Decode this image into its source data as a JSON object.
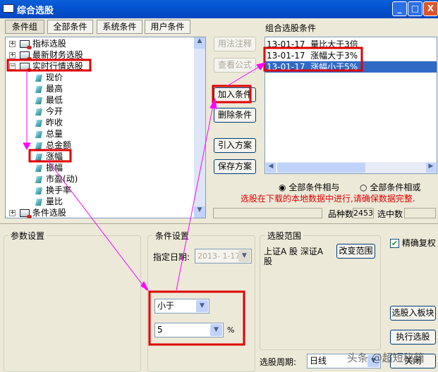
{
  "window": {
    "title": "综合选股",
    "buttons": {
      "minimize": "_",
      "maximize": "□",
      "close": "X"
    }
  },
  "tabs": [
    "条件组",
    "全部条件",
    "系统条件",
    "用户条件"
  ],
  "tree": {
    "groups": [
      {
        "label": "指标选股",
        "expander": "+"
      },
      {
        "label": "最新财务选股",
        "expander": "+"
      },
      {
        "label": "实时行情选股",
        "expander": "−"
      }
    ],
    "leaves": [
      "现价",
      "最高",
      "最低",
      "今开",
      "昨收",
      "总量",
      "总金额",
      "涨幅",
      "振幅",
      "市盈(动)",
      "换手率",
      "量比"
    ],
    "last_group": {
      "label": "条件选股",
      "expander": "+"
    }
  },
  "actions": {
    "usage": "用法注释",
    "view_formula": "查看公式",
    "add": "加入条件",
    "delete": "删除条件",
    "import": "引入方案",
    "save": "保存方案"
  },
  "combo": {
    "title": "组合选股条件",
    "items": [
      "13-01-17  量比大于3倍",
      "13-01-17  涨幅大于3%",
      "13-01-17  涨幅小于5%"
    ],
    "selected_index": 2
  },
  "logic": {
    "and_label": "全部条件相与",
    "or_label": "全部条件相或",
    "selected": "and"
  },
  "warning": "选股在下载的本地数据中进行,请确保数据完整.",
  "status": {
    "count_label": "品种数",
    "count_value": "2453",
    "selected_label": "选中数",
    "selected_value": ""
  },
  "params": {
    "title": "参数设置"
  },
  "condition": {
    "title": "条件设置",
    "date_label": "指定日期:",
    "date_value": "2013- 1-17",
    "operator": "小于",
    "value": "5",
    "unit": "%"
  },
  "scope": {
    "title": "选股范围",
    "text": "上证A 股 深证A 股",
    "change_button": "改变范围"
  },
  "options": {
    "exact_rights_label": "精确复权",
    "exact_rights_checked": true
  },
  "bottom": {
    "to_block": "选股入板块",
    "execute": "执行选股",
    "close": "关闭",
    "period_label": "选股周期:",
    "period_value": "日线"
  },
  "watermark": "头条 @超短秘籍",
  "colors": {
    "title_bar": "#0452d0",
    "selection": "#316ac5",
    "warning": "#e00000",
    "annotation_box": "#e00000",
    "annotation_arrow": "#ff00ff"
  }
}
